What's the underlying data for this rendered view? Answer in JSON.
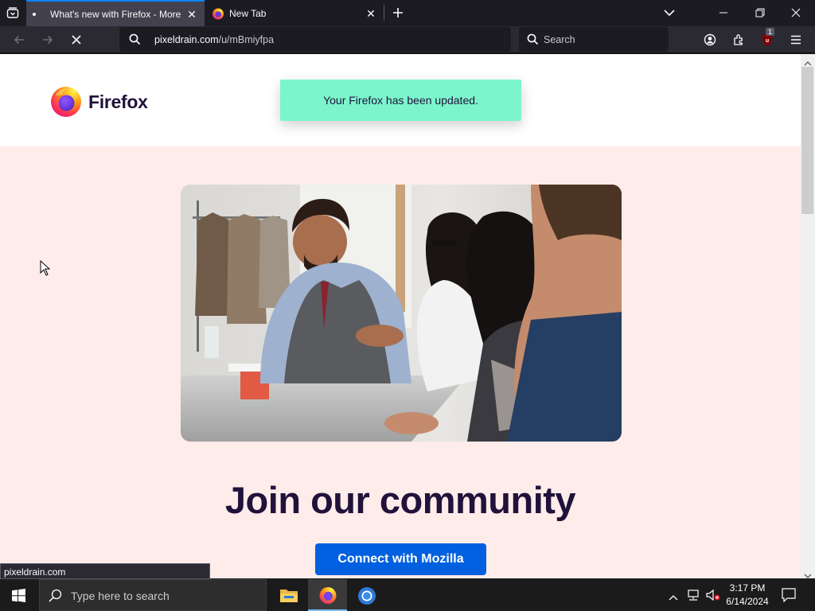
{
  "browser": {
    "tabs": [
      {
        "title": "What's new with Firefox - More",
        "active": true
      },
      {
        "title": "New Tab",
        "active": false
      }
    ],
    "url": {
      "host": "pixeldrain.com",
      "path": "/u/mBmiyfpa"
    },
    "search_placeholder": "Search",
    "notification_count": "1",
    "status_url": "pixeldrain.com"
  },
  "page": {
    "brand_name": "Firefox",
    "toast": "Your Firefox has been updated.",
    "heading": "Join our community",
    "cta_label": "Connect with Mozilla"
  },
  "taskbar": {
    "search_placeholder": "Type here to search",
    "time": "3:17 PM",
    "date": "6/14/2024"
  },
  "colors": {
    "accent": "#0060df",
    "toast_bg": "#7cf5cc",
    "page_bg": "#fdecea",
    "heading": "#20123a"
  },
  "icons": [
    "tab-overview-icon",
    "back-arrow-icon",
    "forward-arrow-icon",
    "stop-icon",
    "search-icon",
    "account-icon",
    "extensions-icon",
    "ublock-icon",
    "menu-icon",
    "windows-start-icon",
    "file-explorer-icon",
    "firefox-icon",
    "chrome-icon",
    "chevron-up-icon",
    "network-icon",
    "volume-muted-icon",
    "notifications-icon"
  ]
}
